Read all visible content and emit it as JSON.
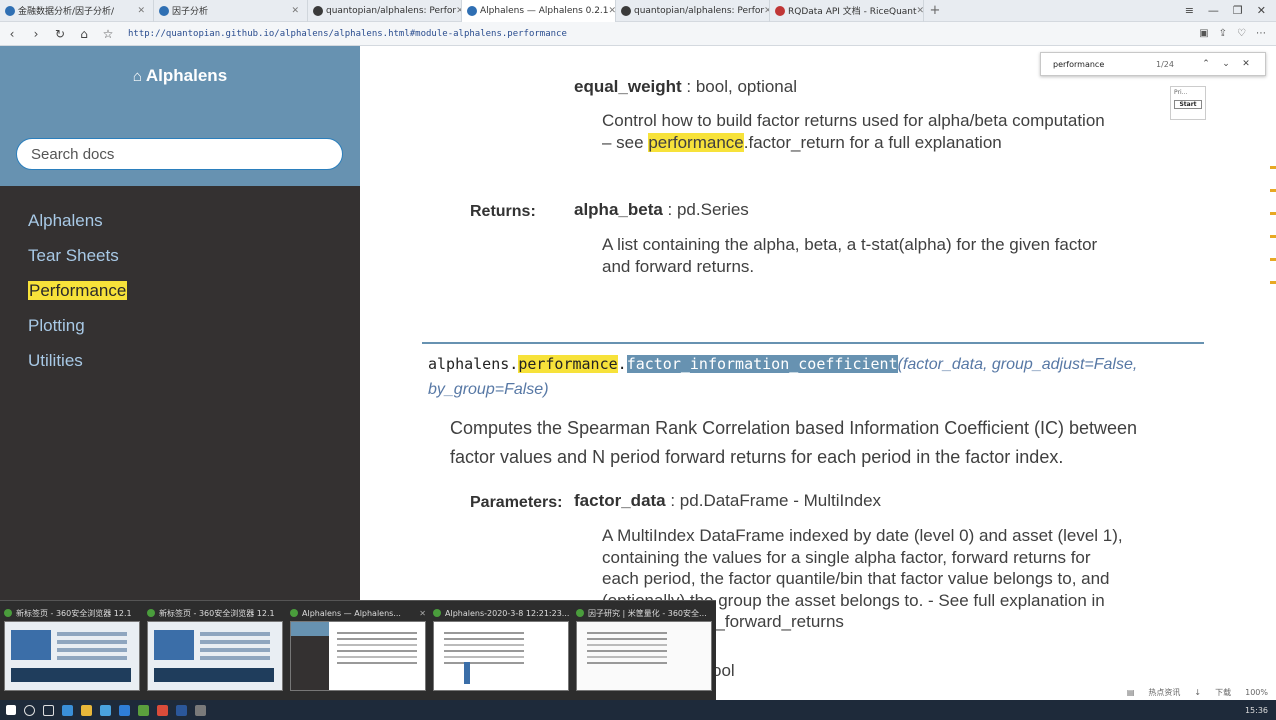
{
  "browser": {
    "tabs": [
      {
        "label": "金融数据分析/因子分析/",
        "icon": "blue"
      },
      {
        "label": "因子分析",
        "icon": "blue"
      },
      {
        "label": "quantopian/alphalens: Perfor",
        "icon": "github"
      },
      {
        "label": "Alphalens — Alphalens 0.2.1",
        "icon": "blue"
      },
      {
        "label": "quantopian/alphalens: Perfor",
        "icon": "github"
      },
      {
        "label": "RQData API 文档 - RiceQuant",
        "icon": "red"
      }
    ],
    "new_tab": "+",
    "url": "http://quantopian.github.io/alphalens/alphalens.html#module-alphalens.performance"
  },
  "find": {
    "query": "performance",
    "count": "1/24",
    "popup_item": "Pri...",
    "popup_button": "Start"
  },
  "sidebar": {
    "title": "Alphalens",
    "search_placeholder": "Search docs",
    "items": [
      {
        "label": "Alphalens"
      },
      {
        "label": "Tear Sheets"
      },
      {
        "label": "Performance"
      },
      {
        "label": "Plotting"
      },
      {
        "label": "Utilities"
      }
    ]
  },
  "doc": {
    "p1_name": "equal_weight",
    "p1_type": " : bool, optional",
    "p1_desc_a": "Control how to build factor returns used for alpha/beta computation",
    "p1_desc_b_pre": "– see ",
    "p1_desc_b_hl": "performance",
    "p1_desc_b_post": ".factor_return for a full explanation",
    "returns_label": "Returns:",
    "r_name": "alpha_beta",
    "r_type": " : pd.Series",
    "r_desc_a": "A list containing the alpha, beta, a t-stat(alpha) for the given factor",
    "r_desc_b": "and forward returns.",
    "sig_module": "alphalens.",
    "sig_hl": "performance",
    "sig_dot": ".",
    "sig_func": "factor_information_coefficient",
    "sig_open": "(",
    "sig_params_a": "factor_data, group_adjust=False,",
    "sig_params_b": "by_group=False",
    "sig_close": ")",
    "desc_a": "Computes the Spearman Rank Correlation based Information Coefficient (IC) between",
    "desc_b": "factor values and N period forward returns for each period in the factor index.",
    "params_label": "Parameters:",
    "fd_name": "factor_data",
    "fd_type": " : pd.DataFrame - MultiIndex",
    "fd_desc_a": "A MultiIndex DataFrame indexed by date (level 0) and asset (level 1),",
    "fd_desc_b": "containing the values for a single alpha factor, forward returns for",
    "fd_desc_c": "each period, the factor quantile/bin that factor value belongs to, and",
    "fd_desc_d": "(optionally) the group the asset belongs to. - See full explanation in",
    "fd_desc_e": "...n_factor_and_forward_returns",
    "next_type_fragment": "ool"
  },
  "taskview": [
    {
      "label": "新标签页 - 360安全浏览器 12.1"
    },
    {
      "label": "新标签页 - 360安全浏览器 12.1"
    },
    {
      "label": "Alphalens — Alphalens..."
    },
    {
      "label": "Alphalens-2020-3-8 12:21:23..."
    },
    {
      "label": "因子研究 | 米筐量化 - 360安全..."
    }
  ],
  "status": {
    "items": [
      "热点资讯",
      "下载",
      "100%"
    ]
  },
  "clock": "15:36"
}
